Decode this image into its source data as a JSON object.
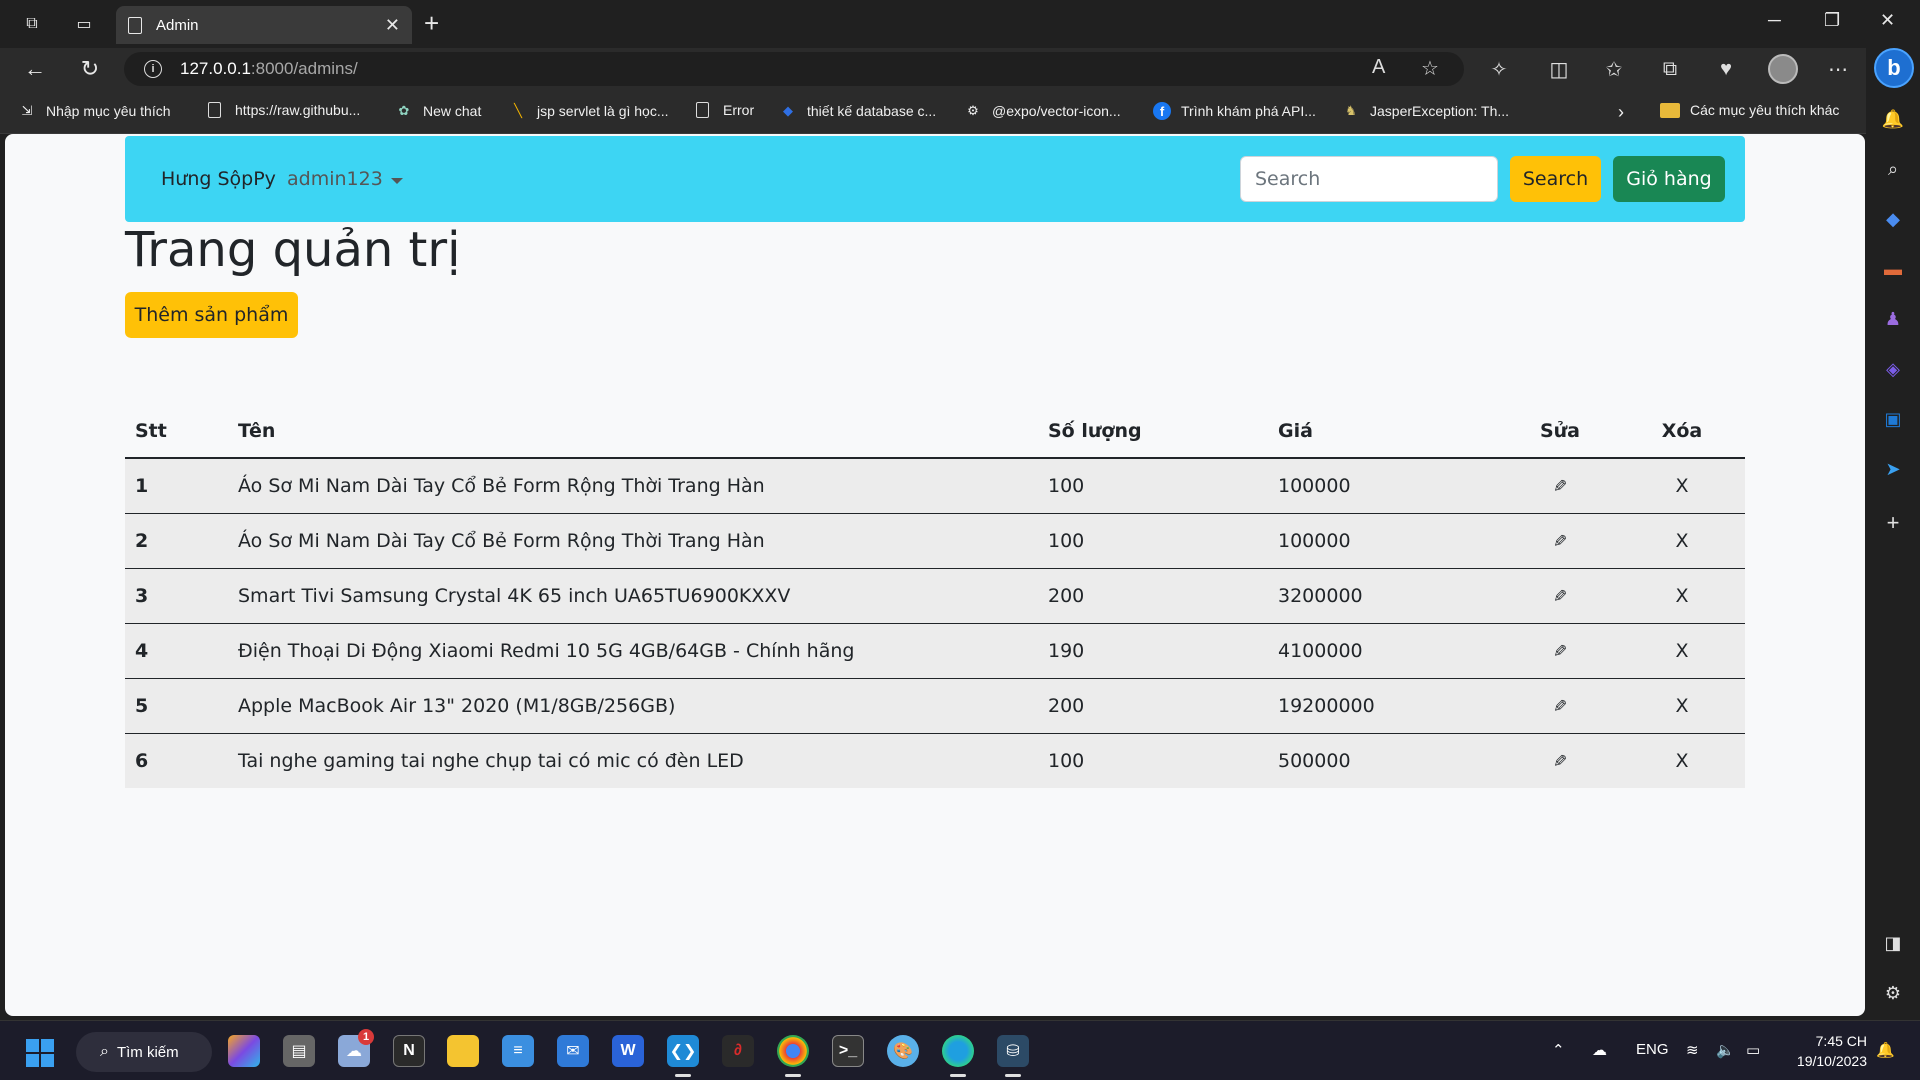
{
  "browser": {
    "tab_title": "Admin",
    "url_host": "127.0.0.1",
    "url_path": ":8000/admins/",
    "bookmarks": [
      {
        "label": "Nhập mục yêu thích",
        "icon": "import-icon"
      },
      {
        "label": "https://raw.githubu...",
        "icon": "page-icon"
      },
      {
        "label": "New chat",
        "icon": "chatgpt-icon"
      },
      {
        "label": "jsp servlet là gì học...",
        "icon": "link-icon"
      },
      {
        "label": "Error",
        "icon": "page-icon"
      },
      {
        "label": "thiết kế database c...",
        "icon": "diamond-icon"
      },
      {
        "label": "@expo/vector-icon...",
        "icon": "expo-icon"
      },
      {
        "label": "Trình khám phá API...",
        "icon": "facebook-icon"
      },
      {
        "label": "JasperException: Th...",
        "icon": "tomcat-icon"
      }
    ],
    "other_favorites": "Các mục yêu thích khác"
  },
  "navbar": {
    "brand": "Hưng SộpPy",
    "username": "admin123",
    "search_placeholder": "Search",
    "search_button": "Search",
    "cart_button": "Giỏ hàng",
    "color": "#3dd5f3"
  },
  "main": {
    "title": "Trang quản trị",
    "add_button": "Thêm sản phẩm"
  },
  "table": {
    "headers": [
      "Stt",
      "Tên",
      "Số lượng",
      "Giá",
      "Sửa",
      "Xóa"
    ],
    "rows": [
      {
        "stt": "1",
        "name": "Áo Sơ Mi Nam Dài Tay Cổ Bẻ Form Rộng Thời Trang Hàn",
        "qty": "100",
        "price": "100000",
        "edit": "✎",
        "del": "X"
      },
      {
        "stt": "2",
        "name": "Áo Sơ Mi Nam Dài Tay Cổ Bẻ Form Rộng Thời Trang Hàn",
        "qty": "100",
        "price": "100000",
        "edit": "✎",
        "del": "X"
      },
      {
        "stt": "3",
        "name": "Smart Tivi Samsung Crystal 4K 65 inch UA65TU6900KXXV",
        "qty": "200",
        "price": "3200000",
        "edit": "✎",
        "del": "X"
      },
      {
        "stt": "4",
        "name": "Điện Thoại Di Động Xiaomi Redmi 10 5G 4GB/64GB - Chính hãng",
        "qty": "190",
        "price": "4100000",
        "edit": "✎",
        "del": "X"
      },
      {
        "stt": "5",
        "name": "Apple MacBook Air 13\" 2020 (M1/8GB/256GB)",
        "qty": "200",
        "price": "19200000",
        "edit": "✎",
        "del": "X"
      },
      {
        "stt": "6",
        "name": "Tai nghe gaming tai nghe chụp tai có mic có đèn LED",
        "qty": "100",
        "price": "500000",
        "edit": "✎",
        "del": "X"
      }
    ]
  },
  "taskbar": {
    "search_label": "Tìm kiếm",
    "badge_count": "1",
    "language": "ENG",
    "time": "7:45 CH",
    "date": "19/10/2023"
  }
}
